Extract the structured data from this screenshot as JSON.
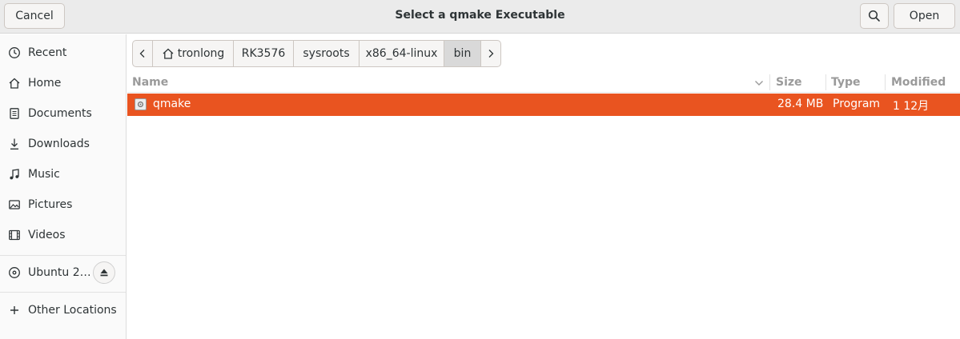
{
  "dialog": {
    "title": "Select a qmake Executable",
    "cancel_label": "Cancel",
    "open_label": "Open",
    "search_icon": "search-icon"
  },
  "sidebar": {
    "items": [
      {
        "label": "Recent",
        "icon": "clock-icon"
      },
      {
        "label": "Home",
        "icon": "home-icon"
      },
      {
        "label": "Documents",
        "icon": "document-icon"
      },
      {
        "label": "Downloads",
        "icon": "download-icon"
      },
      {
        "label": "Music",
        "icon": "music-icon"
      },
      {
        "label": "Pictures",
        "icon": "picture-icon"
      },
      {
        "label": "Videos",
        "icon": "video-icon"
      }
    ],
    "device": {
      "label": "Ubuntu 2…",
      "icon": "disc-icon",
      "eject_icon": "eject-icon"
    },
    "other": {
      "label": "Other Locations",
      "icon": "plus-icon"
    }
  },
  "pathbar": {
    "segments": [
      "tronlong",
      "RK3576",
      "sysroots",
      "x86_64-linux",
      "bin"
    ],
    "active": "bin"
  },
  "list": {
    "columns": {
      "name": "Name",
      "size": "Size",
      "type": "Type",
      "modified": "Modified"
    },
    "rows": [
      {
        "name": "qmake",
        "size": "28.4 MB",
        "type": "Program",
        "modified": "1 12月",
        "selected": true
      }
    ]
  },
  "colors": {
    "accent": "#e95420"
  }
}
